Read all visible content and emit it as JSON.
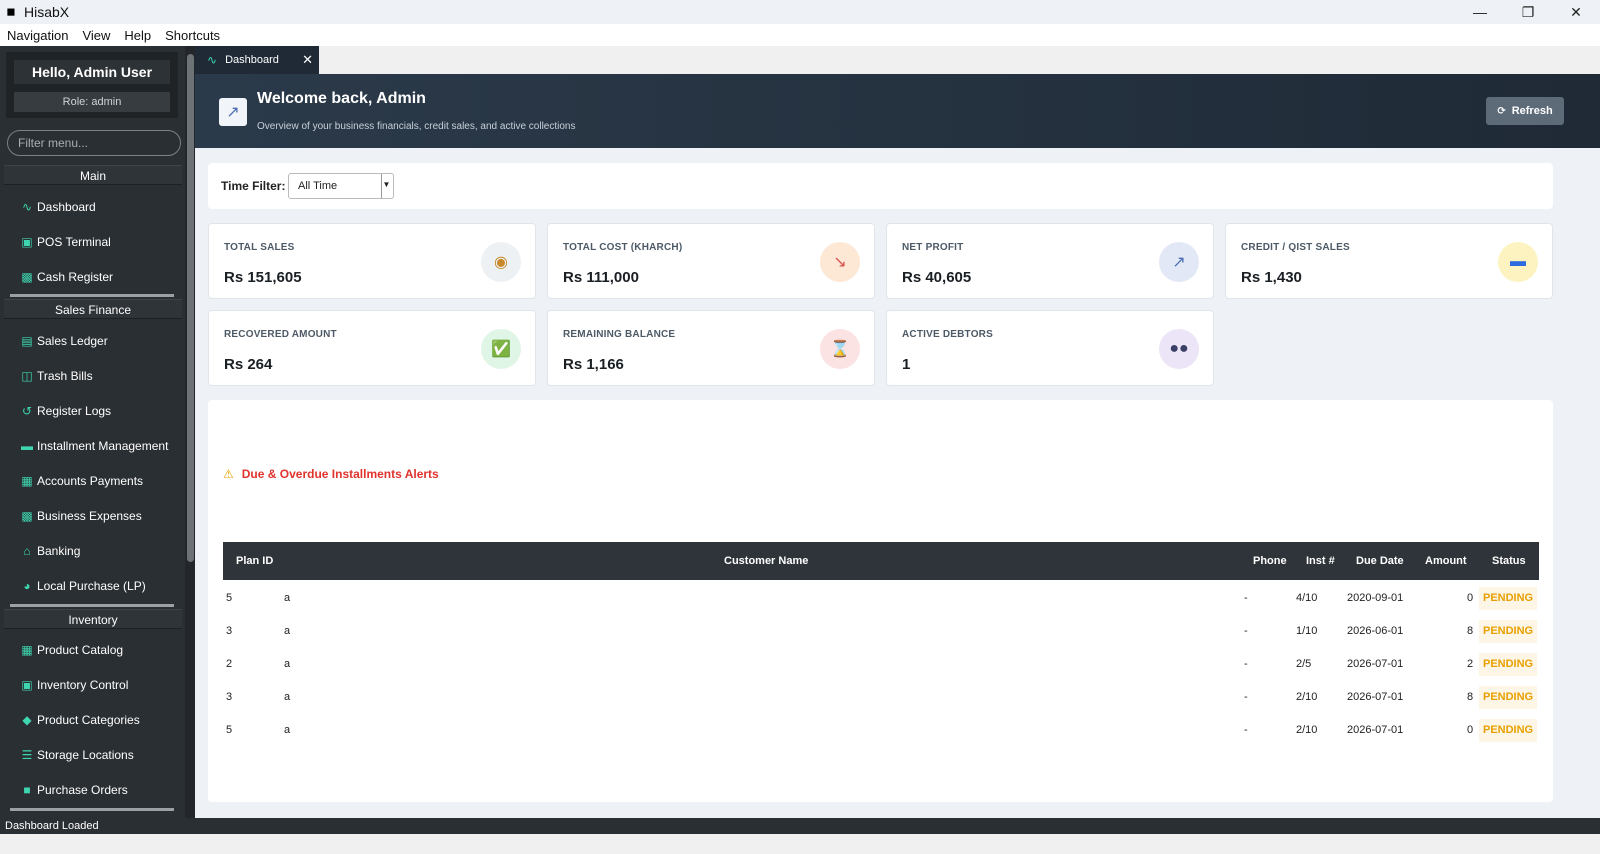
{
  "window": {
    "title": "HisabX",
    "icon": "app-logo-icon"
  },
  "menu": [
    "Navigation",
    "View",
    "Help",
    "Shortcuts"
  ],
  "sidebar": {
    "greeting": "Hello, Admin User",
    "role": "Role: admin",
    "filter_placeholder": "Filter menu...",
    "sections": [
      {
        "title": "Main",
        "items": [
          "Dashboard",
          "POS Terminal",
          "Cash Register"
        ]
      },
      {
        "title": "Sales  Finance",
        "items": [
          "Sales Ledger",
          "Trash Bills",
          "Register Logs",
          "Installment Management",
          "Accounts  Payments",
          "Business Expenses",
          "Banking",
          "Local Purchase (LP)"
        ]
      },
      {
        "title": "Inventory",
        "items": [
          "Product Catalog",
          "Inventory Control",
          "Product Categories",
          "Storage Locations",
          "Purchase Orders"
        ]
      }
    ]
  },
  "tab": {
    "label": "Dashboard"
  },
  "banner": {
    "title": "Welcome back, Admin",
    "subtitle": "Overview of your business financials, credit sales, and active collections",
    "refresh_label": "Refresh"
  },
  "filter": {
    "label": "Time Filter:",
    "value": "All Time"
  },
  "cards": [
    {
      "label": "TOTAL SALES",
      "value": "Rs 151,605",
      "icon": "money-bag-icon",
      "icon_bg": "#eef1f4"
    },
    {
      "label": "TOTAL COST (KHARCH)",
      "value": "Rs 111,000",
      "icon": "chart-down-icon",
      "icon_bg": "#fde8d6"
    },
    {
      "label": "NET PROFIT",
      "value": "Rs 40,605",
      "icon": "chart-up-icon",
      "icon_bg": "#e3e8f7"
    },
    {
      "label": "CREDIT / QIST SALES",
      "value": "Rs 1,430",
      "icon": "credit-card-icon",
      "icon_bg": "#fdf3c0"
    },
    {
      "label": "RECOVERED AMOUNT",
      "value": "Rs 264",
      "icon": "check-icon",
      "icon_bg": "#dff5e6"
    },
    {
      "label": "REMAINING BALANCE",
      "value": "Rs 1,166",
      "icon": "hourglass-icon",
      "icon_bg": "#fbe3e3"
    },
    {
      "label": "ACTIVE DEBTORS",
      "value": "1",
      "icon": "users-icon",
      "icon_bg": "#ece4f7"
    }
  ],
  "alerts": {
    "title": "Due & Overdue Installments Alerts",
    "columns": [
      "Plan ID",
      "Customer Name",
      "Phone",
      "Inst #",
      "Due Date",
      "Amount",
      "Status"
    ],
    "rows": [
      [
        "5",
        "a",
        "-",
        "4/10",
        "2020-09-01",
        "0",
        "PENDING"
      ],
      [
        "3",
        "a",
        "-",
        "1/10",
        "2026-06-01",
        "8",
        "PENDING"
      ],
      [
        "2",
        "a",
        "-",
        "2/5",
        "2026-07-01",
        "2",
        "PENDING"
      ],
      [
        "3",
        "a",
        "-",
        "2/10",
        "2026-07-01",
        "8",
        "PENDING"
      ],
      [
        "5",
        "a",
        "-",
        "2/10",
        "2026-07-01",
        "0",
        "PENDING"
      ]
    ]
  },
  "status": "Dashboard Loaded",
  "colors": {
    "accent": "#3ed6b0",
    "pending": "#e8a000",
    "alert": "#e0332d",
    "sidebar_bg": "#2a2f33"
  }
}
